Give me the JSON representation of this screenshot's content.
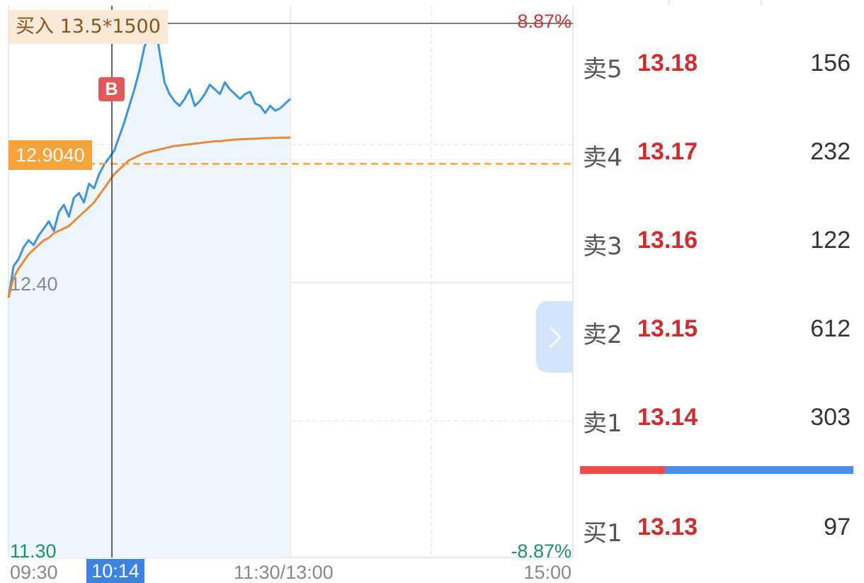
{
  "chart": {
    "order_tag": "买入 13.5*1500",
    "avg_price_tag": "12.9040",
    "buy_marker": "B",
    "top_change": "8.87%",
    "bottom_change": "-8.87%",
    "mid_price": "12.40",
    "low_price": "11.30",
    "time_labels": {
      "open": "09:30",
      "midday": "11:30/13:00",
      "close": "15:00",
      "cursor": "10:14"
    },
    "colors": {
      "price_line": "#3b94df",
      "avg_line": "#e88a3c",
      "avg_dashed": "#f6a43a",
      "fill": "#eef5fc",
      "up": "#c8343c",
      "down": "#1e9266"
    }
  },
  "chart_data": {
    "type": "line",
    "series": [
      {
        "values": [
          12.34,
          12.47,
          12.5,
          12.55,
          12.58,
          12.56,
          12.6,
          12.63,
          12.66,
          12.62,
          12.7,
          12.73,
          12.68,
          12.76,
          12.78,
          12.74,
          12.82,
          12.8,
          12.86,
          12.9,
          12.93,
          12.96,
          13.02,
          13.08,
          13.15,
          13.22,
          13.3,
          13.4,
          13.45,
          13.52,
          13.38,
          13.25,
          13.2,
          13.17,
          13.15,
          13.18,
          13.22,
          13.15,
          13.17,
          13.2,
          13.24,
          13.22,
          13.2,
          13.25,
          13.22,
          13.2,
          13.18,
          13.2,
          13.21,
          13.16,
          13.15,
          13.12,
          13.15,
          13.13,
          13.14,
          13.16,
          13.18
        ]
      },
      {
        "values": [
          12.34,
          12.42,
          12.46,
          12.49,
          12.52,
          12.54,
          12.56,
          12.58,
          12.59,
          12.61,
          12.62,
          12.63,
          12.64,
          12.66,
          12.68,
          12.7,
          12.72,
          12.74,
          12.77,
          12.8,
          12.83,
          12.86,
          12.88,
          12.9,
          12.92,
          12.93,
          12.94,
          12.95,
          12.955,
          12.96,
          12.965,
          12.97,
          12.975,
          12.98,
          12.982,
          12.985,
          12.987,
          12.99,
          12.992,
          12.995,
          12.997,
          13.0,
          13.0,
          13.003,
          13.005,
          13.007,
          13.008,
          13.009,
          13.01,
          13.011,
          13.012,
          13.013,
          13.014,
          13.014,
          13.015,
          13.015,
          13.016
        ]
      }
    ],
    "avg_price": 12.904,
    "ylim": [
      11.3,
      13.5
    ],
    "x_ticks": [
      "09:30",
      "11:30/13:00",
      "15:00"
    ],
    "grid": true,
    "order_book": {
      "sell": [
        {
          "level": "卖5",
          "price": 13.18,
          "volume": 156
        },
        {
          "level": "卖4",
          "price": 13.17,
          "volume": 232
        },
        {
          "level": "卖3",
          "price": 13.16,
          "volume": 122
        },
        {
          "level": "卖2",
          "price": 13.15,
          "volume": 612
        },
        {
          "level": "卖1",
          "price": 13.14,
          "volume": 303
        }
      ],
      "buy": [
        {
          "level": "买1",
          "price": 13.13,
          "volume": 97
        }
      ],
      "buy_ratio": 0.31
    }
  },
  "orderbook": {
    "rows": [
      {
        "side": "卖5",
        "price": "13.18",
        "vol": "156"
      },
      {
        "side": "卖4",
        "price": "13.17",
        "vol": "232"
      },
      {
        "side": "卖3",
        "price": "13.16",
        "vol": "122"
      },
      {
        "side": "卖2",
        "price": "13.15",
        "vol": "612"
      },
      {
        "side": "卖1",
        "price": "13.14",
        "vol": "303"
      },
      {
        "side": "买1",
        "price": "13.13",
        "vol": "97"
      }
    ]
  },
  "icons": {
    "expand": "chevron-right-icon"
  }
}
